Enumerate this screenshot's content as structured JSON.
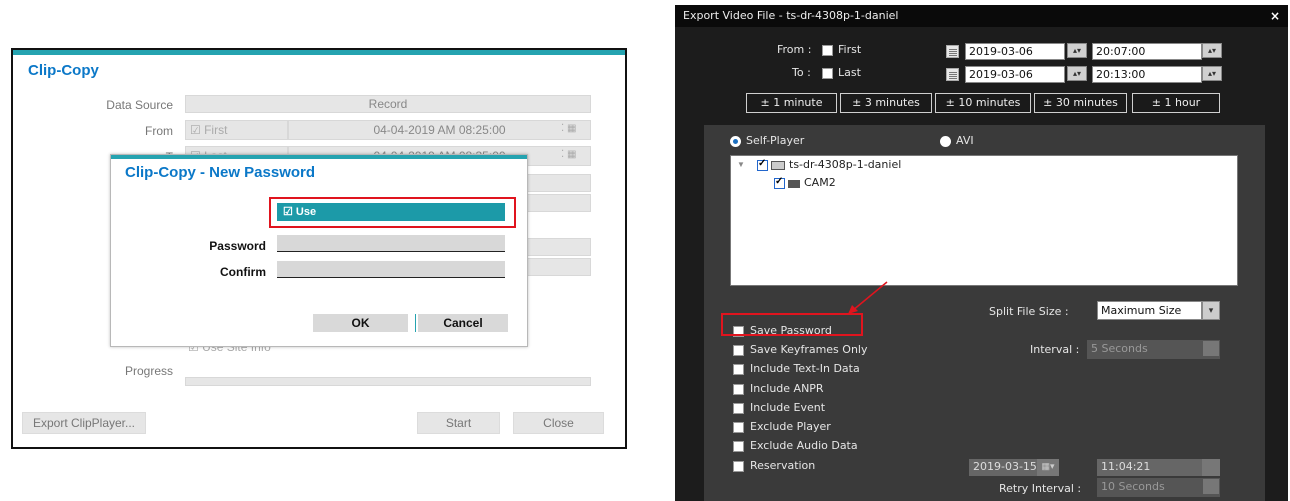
{
  "clip_copy": {
    "title": "Clip-Copy",
    "data_source_label": "Data Source",
    "data_source_value": "Record",
    "from_label": "From",
    "from_first": "☑ First",
    "from_datetime": "04-04-2019 AM 08:25:00",
    "to_label": "T",
    "to_last": "☑ Last",
    "to_datetime": "04-04-2019 AM 08:35:00",
    "use_site_info": "☑ Use Site Info",
    "progress_label": "Progress",
    "export_clipplayer_button": "Export ClipPlayer...",
    "start_button": "Start",
    "close_button": "Close",
    "new_password_dialog": {
      "title": "Clip-Copy - New Password",
      "use_label": "☑ Use",
      "password_label": "Password",
      "confirm_label": "Confirm",
      "ok_button": "OK",
      "cancel_button": "Cancel"
    }
  },
  "export_video": {
    "title": "Export Video File - ts-dr-4308p-1-daniel",
    "close_glyph": "×",
    "from_label": "From :",
    "from_first": "First",
    "from_date": "2019-03-06",
    "from_time": "20:07:00",
    "to_label": "To :",
    "to_last": "Last",
    "to_date": "2019-03-06",
    "to_time": "20:13:00",
    "durations": [
      "± 1 minute",
      "± 3 minutes",
      "± 10 minutes",
      "± 30 minutes",
      "± 1 hour"
    ],
    "self_player_label": "Self-Player",
    "avi_label": "AVI",
    "tree_root": "ts-dr-4308p-1-daniel",
    "tree_child": "CAM2",
    "split_file_size_label": "Split File Size :",
    "split_file_size_value": "Maximum Size",
    "options": [
      "Save Password",
      "Save Keyframes Only",
      "Include Text-In Data",
      "Include ANPR",
      "Include Event",
      "Exclude Player",
      "Exclude Audio Data",
      "Reservation"
    ],
    "interval_label": "Interval :",
    "interval_value": "5 Seconds",
    "reservation_date": "2019-03-15",
    "reservation_time": "11:04:21",
    "retry_interval_label": "Retry Interval :",
    "retry_interval_value": "10 Seconds"
  },
  "colors": {
    "accent_teal": "#1c9aa8",
    "title_blue": "#0b78c8",
    "highlight_red": "#e0141e"
  }
}
